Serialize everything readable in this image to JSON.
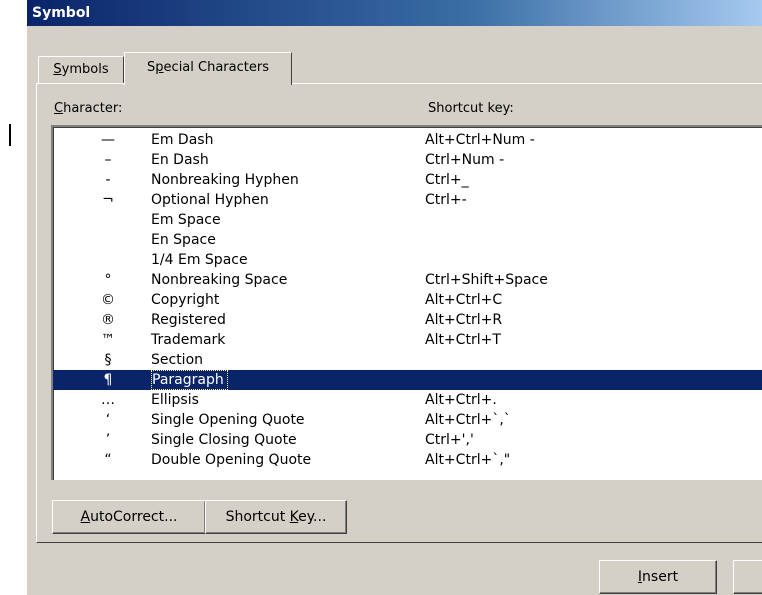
{
  "window": {
    "title": "Symbol"
  },
  "tabs": [
    {
      "label": "Symbols",
      "underline": "S",
      "rest": "ymbols"
    },
    {
      "label": "Special Characters",
      "pre": "S",
      "underline": "p",
      "rest": "ecial Characters"
    }
  ],
  "headers": {
    "character_u": "C",
    "character_rest": "haracter:",
    "shortcut": "Shortcut key:"
  },
  "rows": [
    {
      "symbol": "—",
      "name": "Em Dash",
      "shortcut": "Alt+Ctrl+Num -"
    },
    {
      "symbol": "–",
      "name": "En Dash",
      "shortcut": "Ctrl+Num -"
    },
    {
      "symbol": "-",
      "name": "Nonbreaking Hyphen",
      "shortcut": "Ctrl+_"
    },
    {
      "symbol": "¬",
      "name": "Optional Hyphen",
      "shortcut": "Ctrl+-"
    },
    {
      "symbol": "",
      "name": "Em Space",
      "shortcut": ""
    },
    {
      "symbol": "",
      "name": "En Space",
      "shortcut": ""
    },
    {
      "symbol": "",
      "name": "1/4 Em Space",
      "shortcut": ""
    },
    {
      "symbol": "°",
      "name": "Nonbreaking Space",
      "shortcut": "Ctrl+Shift+Space"
    },
    {
      "symbol": "©",
      "name": "Copyright",
      "shortcut": "Alt+Ctrl+C"
    },
    {
      "symbol": "®",
      "name": "Registered",
      "shortcut": "Alt+Ctrl+R"
    },
    {
      "symbol": "™",
      "name": "Trademark",
      "shortcut": "Alt+Ctrl+T"
    },
    {
      "symbol": "§",
      "name": "Section",
      "shortcut": ""
    },
    {
      "symbol": "¶",
      "name": "Paragraph",
      "shortcut": ""
    },
    {
      "symbol": "…",
      "name": "Ellipsis",
      "shortcut": "Alt+Ctrl+."
    },
    {
      "symbol": "‘",
      "name": "Single Opening Quote",
      "shortcut": "Alt+Ctrl+`,`"
    },
    {
      "symbol": "’",
      "name": "Single Closing Quote",
      "shortcut": "Ctrl+','"
    },
    {
      "symbol": "“",
      "name": "Double Opening Quote",
      "shortcut": "Alt+Ctrl+`,\""
    }
  ],
  "selected_row": "Paragraph",
  "buttons": {
    "autocorrect_u": "A",
    "autocorrect_rest": "utoCorrect...",
    "shortcut_pre": "Shortcut ",
    "shortcut_u": "K",
    "shortcut_rest": "ey...",
    "insert_u": "I",
    "insert_rest": "nsert"
  },
  "colors": {
    "face": "#d4d0c8",
    "title_start": "#0a246a",
    "title_end": "#a6caf0",
    "selection": "#0a246a"
  }
}
